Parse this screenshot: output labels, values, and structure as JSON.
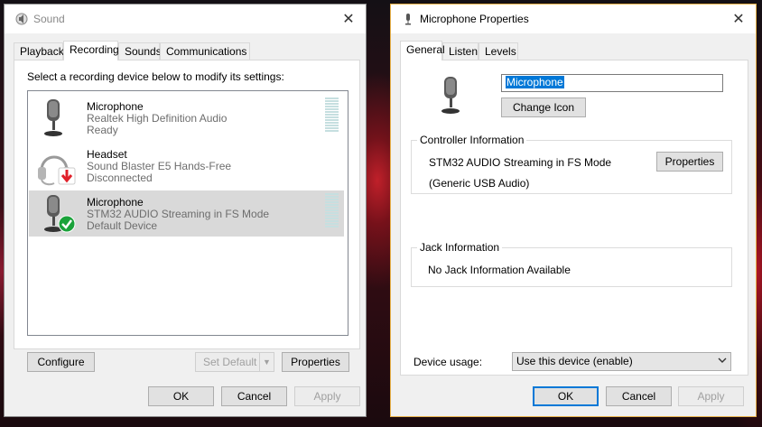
{
  "sound_window": {
    "title": "Sound",
    "tabs": [
      {
        "label": "Playback"
      },
      {
        "label": "Recording"
      },
      {
        "label": "Sounds"
      },
      {
        "label": "Communications"
      }
    ],
    "instruction": "Select a recording device below to modify its settings:",
    "devices": [
      {
        "name": "Microphone",
        "description": "Realtek High Definition Audio",
        "status": "Ready",
        "icon": "microphone-icon",
        "badge": "none"
      },
      {
        "name": "Headset",
        "description": "Sound Blaster E5 Hands-Free",
        "status": "Disconnected",
        "icon": "headset-icon",
        "badge": "disconnected-arrow-icon"
      },
      {
        "name": "Microphone",
        "description": "STM32 AUDIO Streaming in FS Mode",
        "status": "Default Device",
        "icon": "microphone-icon",
        "badge": "default-check-icon"
      }
    ],
    "buttons": {
      "configure": "Configure",
      "set_default": "Set Default",
      "properties": "Properties",
      "ok": "OK",
      "cancel": "Cancel",
      "apply": "Apply"
    }
  },
  "mic_window": {
    "title": "Microphone Properties",
    "tabs": [
      {
        "label": "General"
      },
      {
        "label": "Listen"
      },
      {
        "label": "Levels"
      }
    ],
    "device_name": "Microphone",
    "change_icon": "Change Icon",
    "controller": {
      "title": "Controller Information",
      "name": "STM32 AUDIO Streaming in FS Mode",
      "driver": "(Generic USB Audio)",
      "properties_button": "Properties"
    },
    "jack": {
      "title": "Jack Information",
      "text": "No Jack Information Available"
    },
    "device_usage_label": "Device usage:",
    "device_usage_value": "Use this device (enable)",
    "buttons": {
      "ok": "OK",
      "cancel": "Cancel",
      "apply": "Apply"
    }
  },
  "colors": {
    "accent": "#0078d7",
    "selected_row": "#d9d9d9",
    "check_green": "#1aa23a",
    "arrow_red": "#e0202a"
  }
}
